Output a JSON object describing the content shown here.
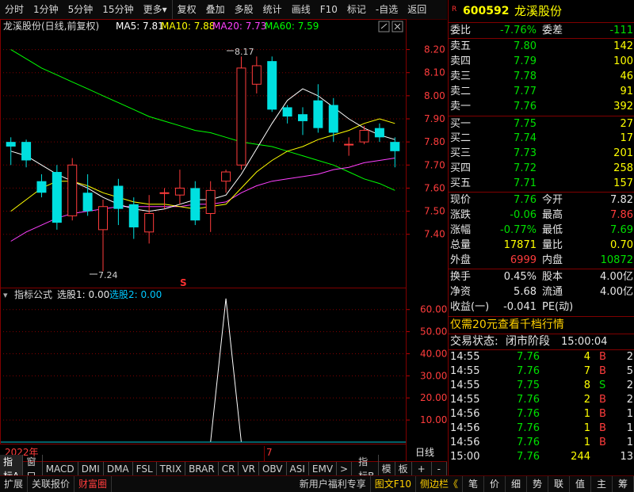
{
  "toolbar": {
    "left": [
      "分时",
      "1分钟",
      "5分钟",
      "15分钟",
      "更多"
    ],
    "more_arrow": "▾",
    "right": [
      "复权",
      "叠加",
      "多股",
      "统计",
      "画线",
      "F10",
      "标记",
      "-自选",
      "返回"
    ]
  },
  "chart": {
    "stock_title": "龙溪股份(日线,前复权)",
    "ma5": "MA5: 7.81",
    "ma10": "MA10: 7.88",
    "ma20": "MA20: 7.73",
    "ma60": "MA60: 7.59",
    "price_ticks": [
      "8.20",
      "8.10",
      "8.00",
      "7.90",
      "7.80",
      "7.70",
      "7.60",
      "7.50",
      "7.40"
    ],
    "high_note": "8.17",
    "low_note": "7.24",
    "signal_mark": "S",
    "ind_title": "指标公式",
    "ind_x1": "选股1: 0.00",
    "ind_x2": "选股2: 0.00",
    "ind_ticks": [
      "60.00",
      "50.00",
      "40.00",
      "30.00",
      "20.00",
      "10.00"
    ],
    "date_left": "2022年",
    "date_mid": "7",
    "period": "日线",
    "colors": {
      "up": "#ff3c3c",
      "down": "#00e0e0",
      "ma5": "#ffffff",
      "ma10": "#ffff00",
      "ma20": "#ff40ff",
      "ma60": "#00ff00",
      "grid": "#800000"
    }
  },
  "chart_data": {
    "type": "candlestick",
    "y_range": [
      7.2,
      8.25
    ],
    "candles": [
      {
        "o": 7.8,
        "c": 7.78,
        "h": 7.82,
        "l": 7.7
      },
      {
        "o": 7.8,
        "c": 7.72,
        "h": 7.81,
        "l": 7.69
      },
      {
        "o": 7.63,
        "c": 7.58,
        "h": 7.66,
        "l": 7.56
      },
      {
        "o": 7.67,
        "c": 7.45,
        "h": 7.7,
        "l": 7.42
      },
      {
        "o": 7.48,
        "c": 7.7,
        "h": 7.73,
        "l": 7.46
      },
      {
        "o": 7.58,
        "c": 7.5,
        "h": 7.66,
        "l": 7.48
      },
      {
        "o": 7.42,
        "c": 7.52,
        "h": 7.55,
        "l": 7.24
      },
      {
        "o": 7.61,
        "c": 7.51,
        "h": 7.64,
        "l": 7.44
      },
      {
        "o": 7.53,
        "c": 7.43,
        "h": 7.56,
        "l": 7.38
      },
      {
        "o": 7.41,
        "c": 7.49,
        "h": 7.57,
        "l": 7.36
      },
      {
        "o": 7.58,
        "c": 7.58,
        "h": 7.6,
        "l": 7.51
      },
      {
        "o": 7.57,
        "c": 7.6,
        "h": 7.68,
        "l": 7.53
      },
      {
        "o": 7.6,
        "c": 7.46,
        "h": 7.63,
        "l": 7.44
      },
      {
        "o": 7.49,
        "c": 7.59,
        "h": 7.63,
        "l": 7.41
      },
      {
        "o": 7.63,
        "c": 7.67,
        "h": 7.68,
        "l": 7.58
      },
      {
        "o": 7.7,
        "c": 8.12,
        "h": 8.17,
        "l": 7.68
      },
      {
        "o": 8.05,
        "c": 8.13,
        "h": 8.17,
        "l": 8.01
      },
      {
        "o": 8.15,
        "c": 7.94,
        "h": 8.17,
        "l": 7.93
      },
      {
        "o": 7.95,
        "c": 7.91,
        "h": 7.96,
        "l": 7.88
      },
      {
        "o": 7.92,
        "c": 7.89,
        "h": 7.95,
        "l": 7.83
      },
      {
        "o": 7.98,
        "c": 7.86,
        "h": 8.05,
        "l": 7.84
      },
      {
        "o": 7.96,
        "c": 7.84,
        "h": 7.99,
        "l": 7.8
      },
      {
        "o": 7.79,
        "c": 7.79,
        "h": 7.82,
        "l": 7.74
      },
      {
        "o": 7.8,
        "c": 7.85,
        "h": 7.87,
        "l": 7.79
      },
      {
        "o": 7.86,
        "c": 7.82,
        "h": 7.88,
        "l": 7.8
      },
      {
        "o": 7.8,
        "c": 7.76,
        "h": 7.82,
        "l": 7.69
      }
    ],
    "ma5": [
      7.76,
      7.74,
      7.7,
      7.66,
      7.63,
      7.6,
      7.56,
      7.53,
      7.51,
      7.5,
      7.51,
      7.53,
      7.55,
      7.55,
      7.57,
      7.66,
      7.77,
      7.88,
      7.98,
      8.03,
      8.0,
      7.95,
      7.9,
      7.86,
      7.83,
      7.81
    ],
    "ma10": [
      7.5,
      7.55,
      7.6,
      7.63,
      7.63,
      7.61,
      7.58,
      7.56,
      7.54,
      7.53,
      7.53,
      7.52,
      7.51,
      7.52,
      7.53,
      7.6,
      7.67,
      7.72,
      7.76,
      7.78,
      7.81,
      7.83,
      7.85,
      7.88,
      7.9,
      7.88
    ],
    "ma20": [
      7.37,
      7.41,
      7.44,
      7.47,
      7.49,
      7.5,
      7.51,
      7.52,
      7.52,
      7.52,
      7.52,
      7.52,
      7.53,
      7.53,
      7.54,
      7.58,
      7.61,
      7.63,
      7.64,
      7.65,
      7.66,
      7.68,
      7.69,
      7.71,
      7.72,
      7.73
    ],
    "ma60": [
      8.2,
      8.16,
      8.12,
      8.09,
      8.06,
      8.03,
      8.0,
      7.97,
      7.94,
      7.91,
      7.89,
      7.87,
      7.85,
      7.84,
      7.82,
      7.8,
      7.79,
      7.78,
      7.76,
      7.74,
      7.72,
      7.7,
      7.67,
      7.64,
      7.62,
      7.59
    ],
    "indicator": {
      "y_range": [
        0,
        66
      ],
      "values": [
        0,
        0,
        0,
        0,
        0,
        0,
        0,
        0,
        0,
        0,
        0,
        0,
        0,
        0,
        65,
        0,
        0,
        0,
        0,
        0,
        0,
        0,
        0,
        0,
        0,
        0
      ]
    }
  },
  "quote": {
    "code": "600592",
    "name": "龙溪股份",
    "r_badge": "R",
    "weibi_l": "委比",
    "weibi": "-7.76%",
    "weicha_l": "委差",
    "weicha": "-111",
    "sell": [
      {
        "label": "卖五",
        "price": "7.80",
        "vol": "142"
      },
      {
        "label": "卖四",
        "price": "7.79",
        "vol": "100"
      },
      {
        "label": "卖三",
        "price": "7.78",
        "vol": "46"
      },
      {
        "label": "卖二",
        "price": "7.77",
        "vol": "91"
      },
      {
        "label": "卖一",
        "price": "7.76",
        "vol": "392"
      }
    ],
    "buy": [
      {
        "label": "买一",
        "price": "7.75",
        "vol": "27"
      },
      {
        "label": "买二",
        "price": "7.74",
        "vol": "17"
      },
      {
        "label": "买三",
        "price": "7.73",
        "vol": "201"
      },
      {
        "label": "买四",
        "price": "7.72",
        "vol": "258"
      },
      {
        "label": "买五",
        "price": "7.71",
        "vol": "157"
      }
    ],
    "stats": [
      {
        "l1": "现价",
        "v1": "7.76",
        "c1": "green",
        "l2": "今开",
        "v2": "7.82",
        "c2": "white"
      },
      {
        "l1": "涨跌",
        "v1": "-0.06",
        "c1": "green",
        "l2": "最高",
        "v2": "7.86",
        "c2": "red"
      },
      {
        "l1": "涨幅",
        "v1": "-0.77%",
        "c1": "green",
        "l2": "最低",
        "v2": "7.69",
        "c2": "green"
      },
      {
        "l1": "总量",
        "v1": "17871",
        "c1": "yellow",
        "l2": "量比",
        "v2": "0.70",
        "c2": "yellow"
      },
      {
        "l1": "外盘",
        "v1": "6999",
        "c1": "red",
        "l2": "内盘",
        "v2": "10872",
        "c2": "green"
      }
    ],
    "stats2": [
      {
        "l1": "换手",
        "v1": "0.45%",
        "l2": "股本",
        "v2": "4.00亿"
      },
      {
        "l1": "净资",
        "v1": "5.68",
        "l2": "流通",
        "v2": "4.00亿"
      },
      {
        "l1": "收益(一)",
        "v1": "-0.041",
        "l2": "PE(动)",
        "v2": ""
      }
    ],
    "promo": "仅需20元查看千档行情",
    "trade_state_l": "交易状态:",
    "trade_state": "闭市阶段",
    "trade_time": "15:00:04",
    "ticks": [
      {
        "t": "14:55",
        "p": "7.76",
        "v": "4",
        "bs": "B",
        "n": "2"
      },
      {
        "t": "14:55",
        "p": "7.76",
        "v": "7",
        "bs": "B",
        "n": "5"
      },
      {
        "t": "14:55",
        "p": "7.75",
        "v": "8",
        "bs": "S",
        "n": "2"
      },
      {
        "t": "14:55",
        "p": "7.76",
        "v": "2",
        "bs": "B",
        "n": "2"
      },
      {
        "t": "14:56",
        "p": "7.76",
        "v": "1",
        "bs": "B",
        "n": "1"
      },
      {
        "t": "14:56",
        "p": "7.76",
        "v": "1",
        "bs": "B",
        "n": "1"
      },
      {
        "t": "14:56",
        "p": "7.76",
        "v": "1",
        "bs": "B",
        "n": "1"
      },
      {
        "t": "15:00",
        "p": "7.76",
        "v": "244",
        "bs": "",
        "n": "13"
      }
    ]
  },
  "tabs": [
    "指标A",
    "窗口",
    "MACD",
    "DMI",
    "DMA",
    "FSL",
    "TRIX",
    "BRAR",
    "CR",
    "VR",
    "OBV",
    "ASI",
    "EMV",
    ">"
  ],
  "tabs_right": [
    "指标B",
    "模",
    "板",
    "+",
    "-"
  ],
  "status": {
    "left": [
      "扩展",
      "关联报价",
      "财富圈"
    ],
    "right": [
      "新用户福利专享",
      "图文F10",
      "侧边栏《"
    ],
    "buttons": [
      "笔",
      "价",
      "细",
      "势",
      "联",
      "值",
      "主",
      "筹"
    ]
  }
}
